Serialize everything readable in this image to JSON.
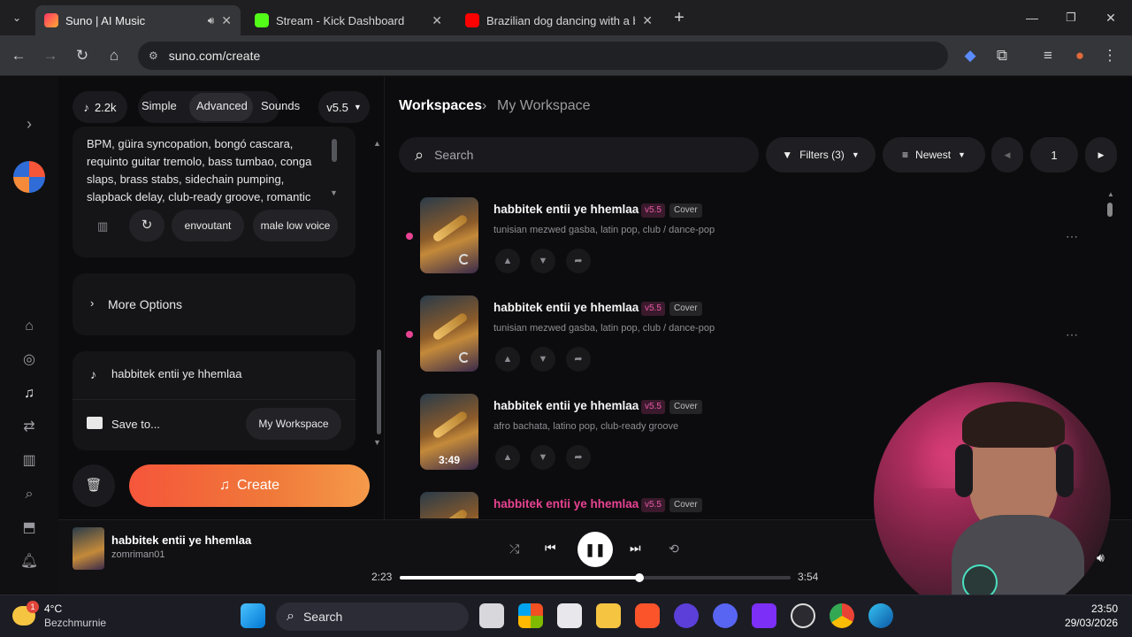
{
  "browser": {
    "tabs": [
      {
        "title": "Suno | AI Music",
        "active": true
      },
      {
        "title": "Stream - Kick Dashboard",
        "active": false
      },
      {
        "title": "Brazilian dog dancing with a bo",
        "active": false
      }
    ],
    "new_tab": "+",
    "url": "suno.com/create"
  },
  "left": {
    "credits": "2.2k",
    "mode_tabs": [
      "Simple",
      "Advanced",
      "Sounds"
    ],
    "active_mode": "Advanced",
    "version": "v5.5",
    "lyrics_lines": [
      "BPM, güira syncopation, bongó cascara,",
      "requinto guitar tremolo, bass tumbao, conga",
      "slaps, brass stabs, sidechain pumping,",
      "slapback delay, club-ready groove, romantic"
    ],
    "style_tags": [
      "envoutant",
      "male low voice"
    ],
    "more_options": "More Options",
    "song_title": "habbitek entii ye hhemlaa",
    "save_to_label": "Save to...",
    "save_to_value": "My Workspace",
    "create_label": "Create"
  },
  "main": {
    "breadcrumb": [
      "Workspaces",
      "My Workspace"
    ],
    "search_placeholder": "Search",
    "filters_label": "Filters (3)",
    "sort_label": "Newest",
    "page": "1",
    "songs": [
      {
        "title": "habbitek entii ye hhemlaa",
        "version": "v5.5",
        "tag": "Cover",
        "genres": "tunisian mezwed gasba, latin pop, club / dance-pop",
        "duration": "",
        "loading": true,
        "dot": true
      },
      {
        "title": "habbitek entii ye hhemlaa",
        "version": "v5.5",
        "tag": "Cover",
        "genres": "tunisian mezwed gasba, latin pop, club / dance-pop",
        "duration": "",
        "loading": true,
        "dot": true
      },
      {
        "title": "habbitek entii ye hhemlaa",
        "version": "v5.5",
        "tag": "Cover",
        "genres": "afro bachata, latino pop, club-ready groove",
        "duration": "3:49",
        "loading": false,
        "dot": false
      },
      {
        "title": "habbitek entii ye hhemlaa",
        "version": "v5.5",
        "tag": "Cover",
        "genres": "",
        "duration": "",
        "loading": false,
        "dot": false
      }
    ]
  },
  "player": {
    "title": "habbitek entii ye hhemlaa",
    "artist": "zomriman01",
    "elapsed": "2:23",
    "total": "3:54",
    "progress": 0.612
  },
  "taskbar": {
    "weather_temp": "4°C",
    "weather_place": "Bezchmurnie",
    "weather_badge": "1",
    "search": "Search",
    "time": "23:50",
    "date": "29/03/2026"
  },
  "colors": {
    "accent_pink": "#e84393",
    "create_gradient_start": "#f5563a",
    "create_gradient_end": "#f58a3a"
  }
}
